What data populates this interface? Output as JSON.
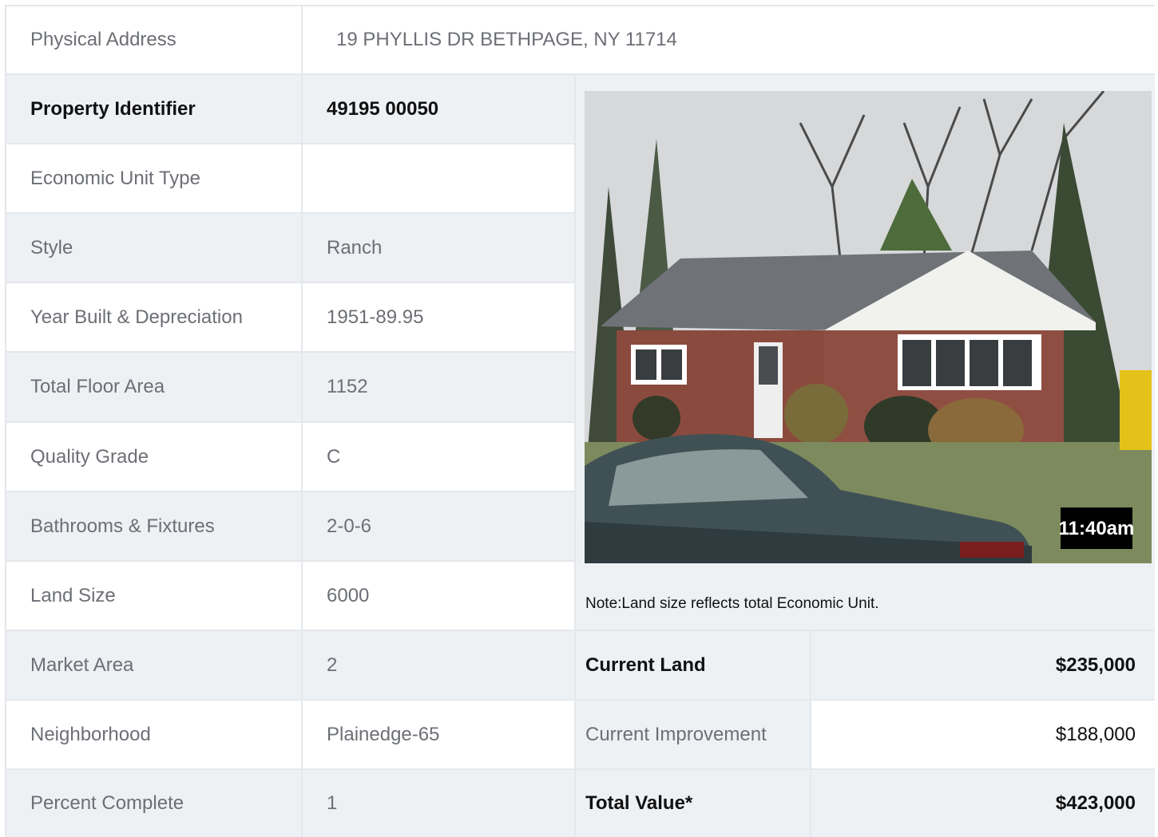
{
  "address": {
    "label": "Physical Address",
    "value": "19  PHYLLIS DR  BETHPAGE, NY  11714"
  },
  "details": [
    {
      "label": "Property Identifier",
      "value": "49195  00050"
    },
    {
      "label": "Economic Unit Type",
      "value": ""
    },
    {
      "label": "Style",
      "value": "Ranch"
    },
    {
      "label": "Year Built & Depreciation",
      "value": "1951-89.95"
    },
    {
      "label": "Total Floor Area",
      "value": "1152"
    },
    {
      "label": "Quality Grade",
      "value": "C"
    },
    {
      "label": "Bathrooms & Fixtures",
      "value": "2-0-6"
    },
    {
      "label": "Land Size",
      "value": "6000"
    },
    {
      "label": "Market Area",
      "value": "2"
    },
    {
      "label": "Neighborhood",
      "value": "Plainedge-65"
    },
    {
      "label": "Percent Complete",
      "value": "1"
    }
  ],
  "photo": {
    "timestamp": "11:40am"
  },
  "note": "Note:Land size reflects total Economic Unit.",
  "values": [
    {
      "label": "Current Land",
      "value": "$235,000"
    },
    {
      "label": "Current Improvement",
      "value": "$188,000"
    },
    {
      "label": "Total Value*",
      "value": "$423,000"
    }
  ],
  "colors": {
    "row_shade": "#eef1f4",
    "border": "#e4e7eb",
    "muted_text": "#6c6f75",
    "strong_text": "#111111"
  }
}
